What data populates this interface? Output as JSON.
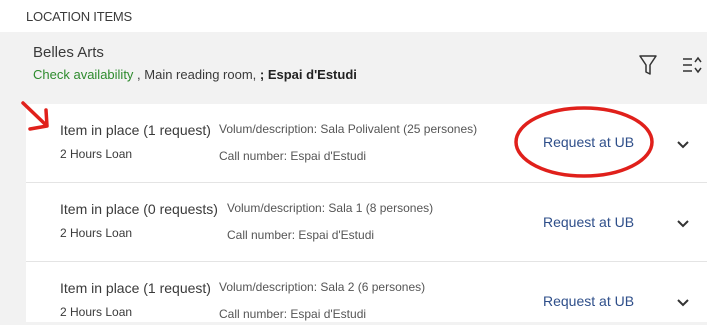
{
  "section": {
    "title": "LOCATION ITEMS"
  },
  "location": {
    "name": "Belles Arts",
    "availability_link": "Check availability",
    "separator1": " , Main reading room, ",
    "sublocation": "; Espai d'Estudi"
  },
  "icons": {
    "filter": "filter-icon",
    "sort": "sort-icon",
    "expand": "chevron-down-icon"
  },
  "items": [
    {
      "status": "Item in place (1 request)",
      "loan": "2 Hours Loan",
      "description": "Volum/description: Sala Polivalent (25 persones)",
      "call_number": "Call number: Espai d'Estudi",
      "request": "Request at UB"
    },
    {
      "status": "Item in place (0 requests)",
      "loan": "2 Hours Loan",
      "description": "Volum/description: Sala 1 (8 persones)",
      "call_number": "Call number: Espai d'Estudi",
      "request": "Request at UB"
    },
    {
      "status": "Item in place (1 request)",
      "loan": "2 Hours Loan",
      "description": "Volum/description: Sala 2 (6 persones)",
      "call_number": "Call number: Espai d'Estudi",
      "request": "Request at UB"
    }
  ],
  "colors": {
    "availability": "#2e8b2e",
    "request_link": "#2f4f8a",
    "annotation": "#e0201b"
  }
}
